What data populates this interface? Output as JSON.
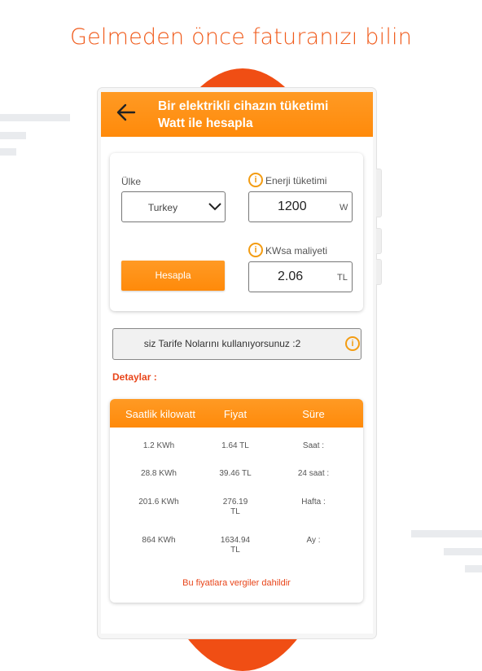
{
  "headline": "Gelmeden önce faturanızı bilin",
  "colors": {
    "accent": "#ff8c0a",
    "brand_red": "#f04e14",
    "link_red": "#e8451a"
  },
  "app_bar": {
    "back_icon": "arrow-left-icon",
    "title_line1": "Bir elektrikli cihazın tüketimi",
    "title_line2": "Watt ile hesapla"
  },
  "form": {
    "country_label": "Ülke",
    "country_value": "Turkey",
    "energy_label": "Enerji tüketimi",
    "energy_value": "1200",
    "energy_unit": "W",
    "cost_label": "KWsa maliyeti",
    "cost_value": "2.06",
    "cost_unit": "TL",
    "calculate_button": "Hesapla"
  },
  "tariff_info": "siz Tarife Nolarını kullanıyorsunuz :2",
  "details_label": "Detaylar :",
  "table": {
    "headers": [
      "Saatlik kilowatt",
      "Fiyat",
      "Süre"
    ],
    "rows": [
      {
        "kwh": "1.2 KWh",
        "price": "1.64  TL",
        "duration": "Saat :"
      },
      {
        "kwh": "28.8 KWh",
        "price": "39.46  TL",
        "duration": "24 saat :"
      },
      {
        "kwh": "201.6 KWh",
        "price": "276.19\nTL",
        "duration": "Hafta :"
      },
      {
        "kwh": "864 KWh",
        "price": "1634.94\nTL",
        "duration": "Ay :"
      }
    ],
    "note": "Bu fiyatlara vergiler dahildir"
  }
}
